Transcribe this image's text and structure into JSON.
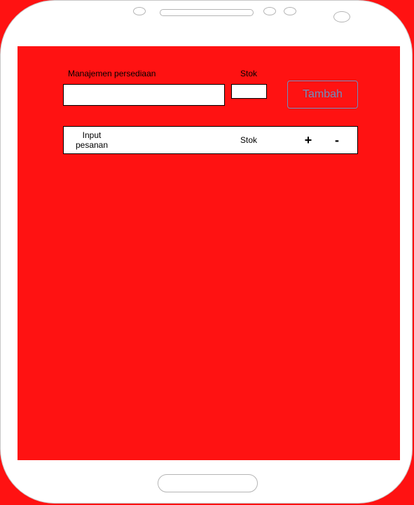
{
  "form": {
    "name_label": "Manajemen persediaan",
    "name_value": "",
    "stock_label": "Stok",
    "stock_value": "",
    "add_button": "Tambah"
  },
  "orders": [
    {
      "input_label_line1": "Input",
      "input_label_line2": "pesanan",
      "stock_label": "Stok",
      "plus_label": "+",
      "minus_label": "-"
    }
  ],
  "colors": {
    "screen_background": "#ff1212",
    "button_accent": "#6c8ebf"
  }
}
